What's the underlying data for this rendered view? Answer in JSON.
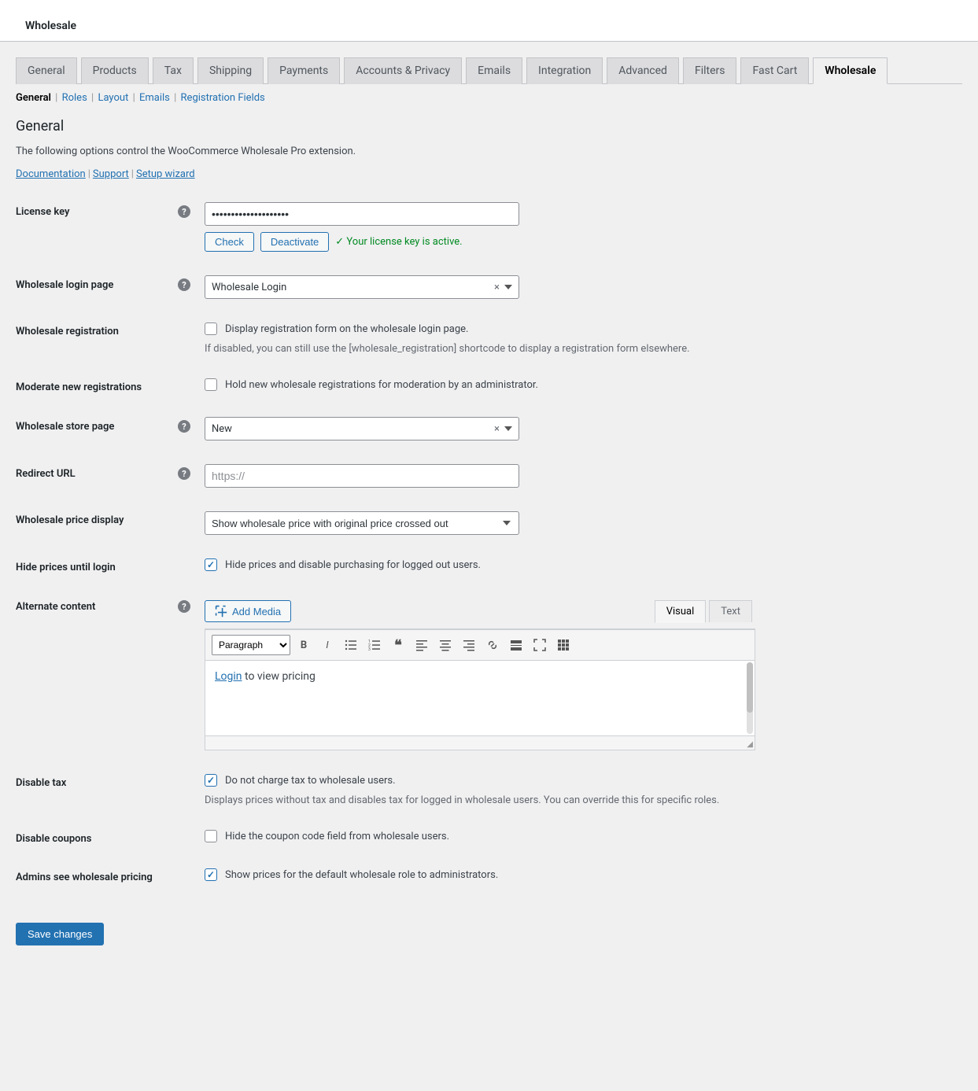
{
  "header": {
    "title": "Wholesale"
  },
  "tabs": [
    {
      "label": "General"
    },
    {
      "label": "Products"
    },
    {
      "label": "Tax"
    },
    {
      "label": "Shipping"
    },
    {
      "label": "Payments"
    },
    {
      "label": "Accounts & Privacy"
    },
    {
      "label": "Emails"
    },
    {
      "label": "Integration"
    },
    {
      "label": "Advanced"
    },
    {
      "label": "Filters"
    },
    {
      "label": "Fast Cart"
    },
    {
      "label": "Wholesale",
      "active": true
    }
  ],
  "subnav": {
    "items": [
      {
        "label": "General",
        "current": true
      },
      {
        "label": "Roles"
      },
      {
        "label": "Layout"
      },
      {
        "label": "Emails"
      },
      {
        "label": "Registration Fields"
      }
    ]
  },
  "section": {
    "title": "General",
    "intro": "The following options control the WooCommerce Wholesale Pro extension.",
    "doclinks": {
      "doc": "Documentation",
      "support": "Support",
      "wizard": "Setup wizard"
    }
  },
  "fields": {
    "license": {
      "label": "License key",
      "check": "Check",
      "deactivate": "Deactivate",
      "status": "✓ Your license key is active."
    },
    "login_page": {
      "label": "Wholesale login page",
      "value": "Wholesale Login"
    },
    "registration": {
      "label": "Wholesale registration",
      "checkbox_label": "Display registration form on the wholesale login page.",
      "help": "If disabled, you can still use the [wholesale_registration] shortcode to display a registration form elsewhere."
    },
    "moderate": {
      "label": "Moderate new registrations",
      "checkbox_label": "Hold new wholesale registrations for moderation by an administrator."
    },
    "store_page": {
      "label": "Wholesale store page",
      "value": "New"
    },
    "redirect": {
      "label": "Redirect URL",
      "placeholder": "https://"
    },
    "price_display": {
      "label": "Wholesale price display",
      "value": "Show wholesale price with original price crossed out"
    },
    "hide_prices": {
      "label": "Hide prices until login",
      "checkbox_label": "Hide prices and disable purchasing for logged out users."
    },
    "alternate": {
      "label": "Alternate content",
      "add_media": "Add Media",
      "tabs": {
        "visual": "Visual",
        "text": "Text"
      },
      "paragraph": "Paragraph",
      "body_link": "Login",
      "body_rest": " to view pricing"
    },
    "disable_tax": {
      "label": "Disable tax",
      "checkbox_label": "Do not charge tax to wholesale users.",
      "help": "Displays prices without tax and disables tax for logged in wholesale users. You can override this for specific roles."
    },
    "disable_coupons": {
      "label": "Disable coupons",
      "checkbox_label": "Hide the coupon code field from wholesale users."
    },
    "admins_see": {
      "label": "Admins see wholesale pricing",
      "checkbox_label": "Show prices for the default wholesale role to administrators."
    }
  },
  "save": "Save changes"
}
